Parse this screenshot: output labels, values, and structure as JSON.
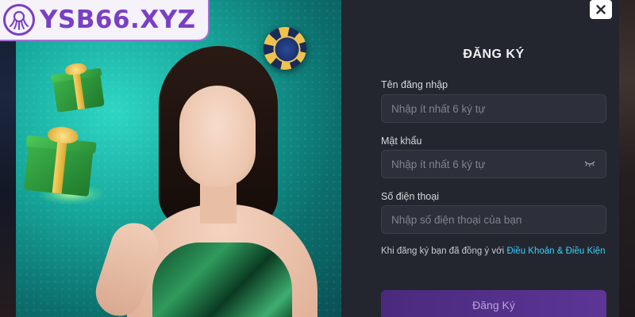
{
  "brand": {
    "name": "YSB66.XYZ"
  },
  "dialog": {
    "title": "ĐĂNG KÝ",
    "fields": {
      "username": {
        "label": "Tên đăng nhập",
        "placeholder": "Nhập ít nhất 6 ký tự",
        "value": ""
      },
      "password": {
        "label": "Mật khẩu",
        "placeholder": "Nhập ít nhất 6 ký tự",
        "value": ""
      },
      "phone": {
        "label": "Số điện thoại",
        "placeholder": "Nhập số điện thoại của bạn",
        "value": ""
      }
    },
    "terms": {
      "text": "Khi đăng ký bạn đã đồng ý với",
      "link": "Điều Khoản & Điều Kiện"
    },
    "submit_label": "Đăng Ký"
  },
  "icons": {
    "close": "close-icon",
    "password_toggle": "eye-closed-icon",
    "logo": "octopus-logo-icon"
  },
  "colors": {
    "brand_purple": "#7a3fc2",
    "dialog_bg": "#23262f",
    "field_bg": "#2d303a",
    "link_cyan": "#3ad0ff",
    "submit_bg": "#4a2a7d"
  }
}
